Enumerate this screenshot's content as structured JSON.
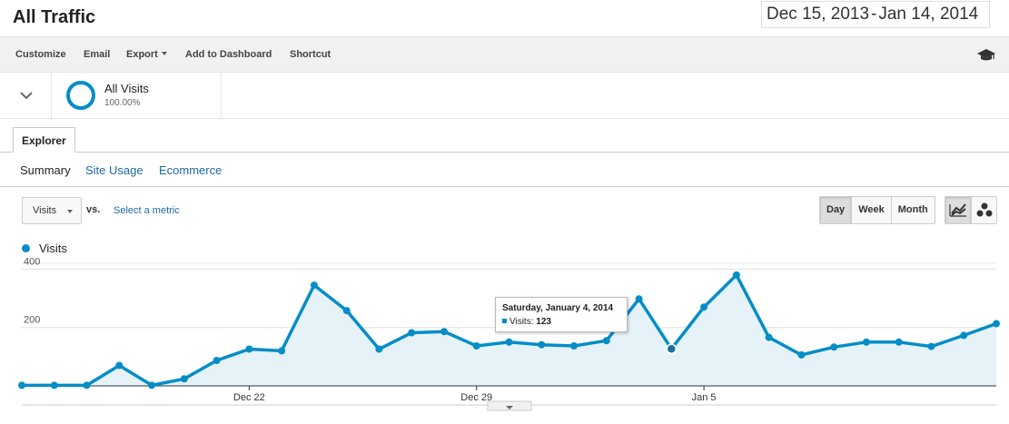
{
  "header": {
    "title": "All Traffic",
    "date_start": "Dec 15, 2013",
    "date_sep": "-",
    "date_end": "Jan 14, 2014"
  },
  "toolbar": {
    "customize": "Customize",
    "email": "Email",
    "export": "Export",
    "add_to_dashboard": "Add to Dashboard",
    "shortcut": "Shortcut",
    "help_icon": "graduation-cap-icon"
  },
  "segment": {
    "name": "All Visits",
    "percent": "100.00%"
  },
  "tabs": {
    "explorer": "Explorer"
  },
  "subtabs": [
    {
      "label": "Summary",
      "active": true
    },
    {
      "label": "Site Usage",
      "active": false
    },
    {
      "label": "Ecommerce",
      "active": false
    }
  ],
  "metric": {
    "selected": "Visits",
    "vs": "vs.",
    "select_metric": "Select a metric"
  },
  "period_buttons": [
    {
      "label": "Day",
      "active": true
    },
    {
      "label": "Week",
      "active": false
    },
    {
      "label": "Month",
      "active": false
    }
  ],
  "view_buttons": [
    "line-chart-icon",
    "motion-chart-icon"
  ],
  "colors": {
    "accent": "#058dc7",
    "fill": "#e5f3f9",
    "link": "#1e68a8"
  },
  "tooltip": {
    "date": "Saturday, January 4, 2014",
    "label": "Visits:",
    "value": "123"
  },
  "chart_data": {
    "type": "area",
    "series": [
      {
        "name": "Visits",
        "values": [
          2,
          2,
          2,
          70,
          2,
          24,
          87,
          126,
          120,
          345,
          258,
          126,
          182,
          186,
          137,
          150,
          141,
          137,
          155,
          298,
          127,
          270,
          380,
          166,
          106,
          133,
          150,
          150,
          135,
          173,
          213
        ]
      }
    ],
    "x_labels": [
      "Dec 22",
      "Dec 29",
      "Jan 5"
    ],
    "x_label_index": [
      7,
      14,
      21
    ],
    "y_ticks": [
      200,
      400
    ],
    "ylim": [
      0,
      420
    ],
    "highlight_index": 20,
    "grid": true,
    "legend": "top-left"
  }
}
